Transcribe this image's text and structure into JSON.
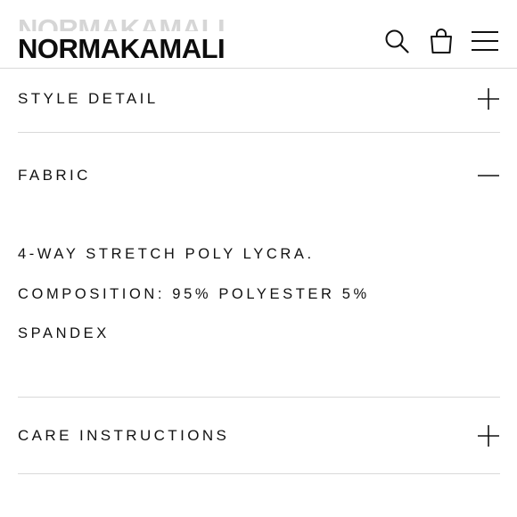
{
  "header": {
    "brand_ghost": "NORMAKAMALI",
    "brand": "NORMAKAMALI",
    "icons": {
      "search": "search-icon",
      "bag": "shopping-bag-icon",
      "menu": "hamburger-menu-icon"
    }
  },
  "accordion": {
    "sections": [
      {
        "title": "STYLE DETAIL",
        "state": "collapsed",
        "toggle_icon": "plus-icon"
      },
      {
        "title": "FABRIC",
        "state": "expanded",
        "toggle_icon": "minus-icon",
        "content": [
          "4-WAY STRETCH POLY LYCRA.",
          "COMPOSITION: 95% POLYESTER 5%",
          "SPANDEX"
        ]
      },
      {
        "title": "CARE INSTRUCTIONS",
        "state": "collapsed",
        "toggle_icon": "plus-icon"
      }
    ]
  },
  "colors": {
    "text": "#111111",
    "divider": "#d9d9d9",
    "logo_ghost": "#d6d6d6",
    "background": "#ffffff"
  }
}
